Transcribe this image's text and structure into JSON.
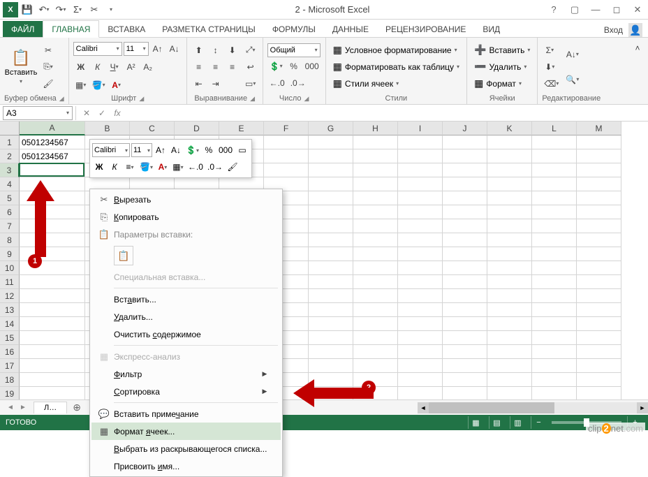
{
  "title": "2 - Microsoft Excel",
  "tabs": {
    "file": "ФАЙЛ",
    "items": [
      "ГЛАВНАЯ",
      "ВСТАВКА",
      "РАЗМЕТКА СТРАНИЦЫ",
      "ФОРМУЛЫ",
      "ДАННЫЕ",
      "РЕЦЕНЗИРОВАНИЕ",
      "ВИД"
    ],
    "login": "Вход"
  },
  "ribbon": {
    "clipboard": {
      "label": "Буфер обмена",
      "paste": "Вставить"
    },
    "font": {
      "label": "Шрифт",
      "name": "Calibri",
      "size": "11"
    },
    "align": {
      "label": "Выравнивание"
    },
    "number": {
      "label": "Число",
      "format": "Общий"
    },
    "styles": {
      "label": "Стили",
      "cond": "Условное форматирование",
      "table": "Форматировать как таблицу",
      "cell": "Стили ячеек"
    },
    "cells": {
      "label": "Ячейки",
      "insert": "Вставить",
      "delete": "Удалить",
      "format": "Формат"
    },
    "editing": {
      "label": "Редактирование"
    }
  },
  "namebox": "A3",
  "columns": [
    "A",
    "B",
    "C",
    "D",
    "E",
    "F",
    "G",
    "H",
    "I",
    "J",
    "K",
    "L",
    "M"
  ],
  "rows_visible": 19,
  "cells": {
    "A1": "0501234567",
    "A2": "0501234567"
  },
  "active_cell": "A3",
  "sheet": {
    "name": "Л…",
    "add": "⊕"
  },
  "status": "ГОТОВО",
  "watermark": {
    "pre": "clip",
    "mid": "2",
    "post": "net",
    "ext": ".com"
  },
  "mini": {
    "font": "Calibri",
    "size": "11"
  },
  "context": {
    "cut": "Вырезать",
    "copy": "Копировать",
    "paste_opts": "Параметры вставки:",
    "paste_special": "Специальная вставка...",
    "insert": "Вставить...",
    "delete": "Удалить...",
    "clear": "Очистить содержимое",
    "quick": "Экспресс-анализ",
    "filter": "Фильтр",
    "sort": "Сортировка",
    "comment": "Вставить примечание",
    "format": "Формат ячеек...",
    "dropdown": "Выбрать из раскрывающегося списка...",
    "name": "Присвоить имя..."
  },
  "badges": {
    "one": "1",
    "two": "2"
  }
}
